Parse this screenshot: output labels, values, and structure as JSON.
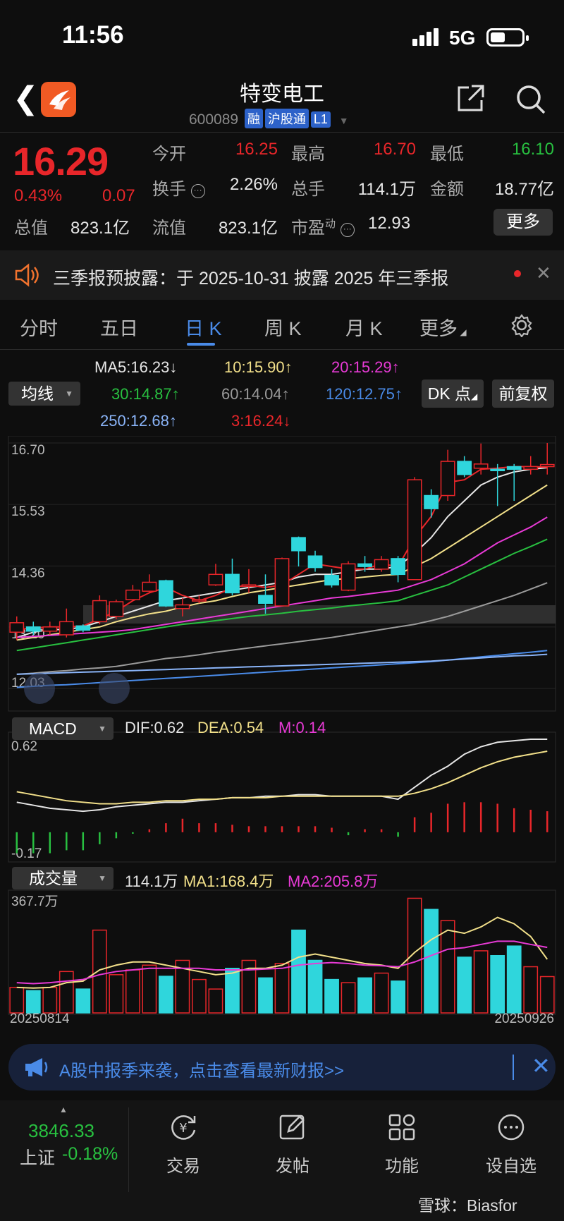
{
  "status": {
    "time": "11:56",
    "network": "5G"
  },
  "header": {
    "stock_name": "特变电工",
    "code": "600089",
    "tags": [
      "融",
      "沪股通",
      "L1"
    ]
  },
  "quote": {
    "price": "16.29",
    "change_pct": "0.43%",
    "change": "0.07",
    "total_value_label": "总值",
    "total_value": "823.1亿",
    "fields": [
      {
        "label": "今开",
        "value": "16.25",
        "color": "red"
      },
      {
        "label": "最高",
        "value": "16.70",
        "color": "red"
      },
      {
        "label": "最低",
        "value": "16.10",
        "color": "green"
      },
      {
        "label": "换手",
        "value": "2.26%",
        "color": "white"
      },
      {
        "label": "总手",
        "value": "114.1万",
        "color": "white"
      },
      {
        "label": "金额",
        "value": "18.77亿",
        "color": "white"
      },
      {
        "label": "流值",
        "value": "823.1亿",
        "color": "white"
      },
      {
        "label": "市盈",
        "label_sup": "动",
        "value": "12.93",
        "color": "white"
      }
    ],
    "more_label": "更多"
  },
  "notice": {
    "text": "三季报预披露：于 2025-10-31 披露 2025 年三季报"
  },
  "tabs": [
    {
      "label": "分时"
    },
    {
      "label": "五日"
    },
    {
      "label": "日 K",
      "active": true
    },
    {
      "label": "周 K"
    },
    {
      "label": "月 K"
    },
    {
      "label": "更多"
    }
  ],
  "ma_bar": {
    "select_label": "均线",
    "items": [
      {
        "text": "MA5:16.23↓",
        "color": "#e6e6e6"
      },
      {
        "text": "10:15.90↑",
        "color": "#f2e08a"
      },
      {
        "text": "20:15.29↑",
        "color": "#e83ad6"
      },
      {
        "text": "30:14.87↑",
        "color": "#28c040"
      },
      {
        "text": "60:14.04↑",
        "color": "#9a9a9a"
      },
      {
        "text": "120:12.75↑",
        "color": "#4a8be8"
      },
      {
        "text": "250:12.68↑",
        "color": "#8ab4f8"
      },
      {
        "text": "3:16.24↓",
        "color": "#e8262a"
      }
    ],
    "dk_label": "DK 点",
    "adjust_label": "前复权"
  },
  "chart_data": {
    "type": "candlestick",
    "price_axis": {
      "ticks": [
        "16.70",
        "15.53",
        "14.36",
        "13.20",
        "12.03"
      ],
      "max": 16.7,
      "min": 12.03
    },
    "dates": {
      "start": "20250814",
      "end": "20250926"
    },
    "candles": [
      {
        "o": 13.1,
        "c": 13.28,
        "h": 13.4,
        "l": 12.95
      },
      {
        "o": 13.2,
        "c": 13.12,
        "h": 13.3,
        "l": 13.05
      },
      {
        "o": 13.12,
        "c": 13.2,
        "h": 13.3,
        "l": 13.05
      },
      {
        "o": 13.05,
        "c": 13.3,
        "h": 13.55,
        "l": 13.0
      },
      {
        "o": 13.22,
        "c": 13.14,
        "h": 13.25,
        "l": 13.1
      },
      {
        "o": 13.3,
        "c": 13.7,
        "h": 13.8,
        "l": 13.25
      },
      {
        "o": 13.4,
        "c": 13.68,
        "h": 13.72,
        "l": 13.35
      },
      {
        "o": 13.72,
        "c": 13.9,
        "h": 14.0,
        "l": 13.7
      },
      {
        "o": 13.88,
        "c": 14.05,
        "h": 14.2,
        "l": 13.85
      },
      {
        "o": 14.08,
        "c": 13.6,
        "h": 14.1,
        "l": 13.58
      },
      {
        "o": 13.55,
        "c": 13.62,
        "h": 13.75,
        "l": 13.4
      },
      {
        "o": 13.72,
        "c": 13.72,
        "h": 13.8,
        "l": 13.65
      },
      {
        "o": 14.0,
        "c": 14.2,
        "h": 14.4,
        "l": 13.98
      },
      {
        "o": 14.2,
        "c": 13.85,
        "h": 14.5,
        "l": 13.8
      },
      {
        "o": 14.0,
        "c": 14.0,
        "h": 14.3,
        "l": 13.85
      },
      {
        "o": 13.8,
        "c": 13.65,
        "h": 14.2,
        "l": 13.45
      },
      {
        "o": 13.6,
        "c": 14.5,
        "h": 14.52,
        "l": 13.6
      },
      {
        "o": 14.9,
        "c": 14.65,
        "h": 14.92,
        "l": 14.35
      },
      {
        "o": 14.55,
        "c": 14.33,
        "h": 14.65,
        "l": 14.25
      },
      {
        "o": 14.18,
        "c": 14.0,
        "h": 14.3,
        "l": 13.95
      },
      {
        "o": 13.9,
        "c": 14.4,
        "h": 14.45,
        "l": 13.88
      },
      {
        "o": 14.4,
        "c": 14.35,
        "h": 14.55,
        "l": 14.25
      },
      {
        "o": 14.3,
        "c": 14.48,
        "h": 14.55,
        "l": 14.25
      },
      {
        "o": 14.5,
        "c": 14.2,
        "h": 14.55,
        "l": 14.05
      },
      {
        "o": 14.1,
        "c": 16.0,
        "h": 16.05,
        "l": 14.1
      },
      {
        "o": 15.7,
        "c": 15.45,
        "h": 15.82,
        "l": 15.28
      },
      {
        "o": 15.7,
        "c": 16.35,
        "h": 16.57,
        "l": 15.6
      },
      {
        "o": 16.35,
        "c": 16.1,
        "h": 16.45,
        "l": 16.05
      },
      {
        "o": 16.22,
        "c": 16.3,
        "h": 16.69,
        "l": 16.1
      },
      {
        "o": 16.2,
        "c": 16.18,
        "h": 16.3,
        "l": 15.5
      },
      {
        "o": 16.25,
        "c": 16.2,
        "h": 16.3,
        "l": 15.6
      },
      {
        "o": 16.2,
        "c": 16.25,
        "h": 16.45,
        "l": 16.1
      },
      {
        "o": 16.25,
        "c": 16.29,
        "h": 16.7,
        "l": 16.1
      }
    ],
    "ma_lines": [
      {
        "name": "MA5",
        "color": "#e6e6e6",
        "values": [
          13.0,
          13.1,
          13.15,
          13.15,
          13.2,
          13.3,
          13.4,
          13.5,
          13.6,
          13.7,
          13.75,
          13.8,
          13.85,
          13.9,
          13.95,
          14.0,
          14.05,
          14.15,
          14.2,
          14.2,
          14.25,
          14.3,
          14.3,
          14.35,
          14.6,
          14.9,
          15.3,
          15.6,
          15.9,
          16.05,
          16.15,
          16.2,
          16.23
        ]
      },
      {
        "name": "MA10",
        "color": "#f2e08a",
        "values": [
          12.95,
          13.0,
          13.05,
          13.1,
          13.15,
          13.2,
          13.3,
          13.38,
          13.45,
          13.5,
          13.58,
          13.65,
          13.7,
          13.78,
          13.85,
          13.9,
          13.95,
          14.0,
          14.05,
          14.1,
          14.12,
          14.15,
          14.18,
          14.2,
          14.35,
          14.5,
          14.7,
          14.9,
          15.1,
          15.3,
          15.5,
          15.7,
          15.9
        ]
      },
      {
        "name": "MA20",
        "color": "#e83ad6",
        "values": [
          13.0,
          13.02,
          13.04,
          13.06,
          13.08,
          13.1,
          13.12,
          13.15,
          13.2,
          13.25,
          13.3,
          13.35,
          13.4,
          13.45,
          13.5,
          13.55,
          13.6,
          13.65,
          13.7,
          13.75,
          13.78,
          13.82,
          13.86,
          13.9,
          14.0,
          14.1,
          14.25,
          14.4,
          14.6,
          14.8,
          14.95,
          15.1,
          15.29
        ]
      },
      {
        "name": "MA30",
        "color": "#28c040",
        "values": [
          12.75,
          12.8,
          12.85,
          12.9,
          12.95,
          13.0,
          13.05,
          13.1,
          13.15,
          13.2,
          13.25,
          13.28,
          13.32,
          13.36,
          13.4,
          13.43,
          13.46,
          13.5,
          13.53,
          13.56,
          13.6,
          13.63,
          13.66,
          13.7,
          13.8,
          13.9,
          14.0,
          14.15,
          14.3,
          14.45,
          14.6,
          14.73,
          14.87
        ]
      },
      {
        "name": "MA60",
        "color": "#9a9a9a",
        "values": [
          12.3,
          12.32,
          12.35,
          12.37,
          12.4,
          12.42,
          12.45,
          12.5,
          12.55,
          12.6,
          12.63,
          12.67,
          12.72,
          12.76,
          12.8,
          12.84,
          12.88,
          12.92,
          12.96,
          13.0,
          13.05,
          13.1,
          13.15,
          13.2,
          13.25,
          13.32,
          13.4,
          13.5,
          13.6,
          13.7,
          13.8,
          13.92,
          14.04
        ]
      },
      {
        "name": "MA120",
        "color": "#4a8be8",
        "values": [
          12.05,
          12.07,
          12.09,
          12.1,
          12.12,
          12.14,
          12.16,
          12.18,
          12.2,
          12.22,
          12.24,
          12.26,
          12.28,
          12.3,
          12.32,
          12.34,
          12.36,
          12.38,
          12.4,
          12.42,
          12.44,
          12.46,
          12.48,
          12.5,
          12.52,
          12.54,
          12.57,
          12.6,
          12.63,
          12.66,
          12.69,
          12.72,
          12.75
        ]
      },
      {
        "name": "MA250",
        "color": "#8ab4f8",
        "values": [
          12.3,
          12.31,
          12.32,
          12.33,
          12.34,
          12.35,
          12.36,
          12.37,
          12.38,
          12.39,
          12.4,
          12.41,
          12.42,
          12.43,
          12.44,
          12.45,
          12.46,
          12.47,
          12.48,
          12.49,
          12.5,
          12.51,
          12.52,
          12.53,
          12.54,
          12.55,
          12.57,
          12.59,
          12.61,
          12.63,
          12.65,
          12.66,
          12.68
        ]
      },
      {
        "name": "MA3",
        "color": "#e8262a",
        "values": [
          13.15,
          13.18,
          13.2,
          13.2,
          13.22,
          13.35,
          13.5,
          13.7,
          13.85,
          13.95,
          13.8,
          13.7,
          13.8,
          13.95,
          14.0,
          13.95,
          14.0,
          14.2,
          14.4,
          14.35,
          14.3,
          14.3,
          14.4,
          14.35,
          14.9,
          15.3,
          15.95,
          16.0,
          16.2,
          16.22,
          16.25,
          16.25,
          16.24
        ]
      }
    ],
    "macd": {
      "select_label": "MACD",
      "dif_label": "DIF:0.62",
      "dea_label": "DEA:0.54",
      "m_label": "M:0.14",
      "axis": {
        "top": "0.62",
        "bottom": "-0.17",
        "max": 0.62,
        "min": -0.17
      },
      "dif": [
        0.2,
        0.18,
        0.16,
        0.15,
        0.14,
        0.15,
        0.17,
        0.18,
        0.19,
        0.2,
        0.2,
        0.21,
        0.22,
        0.23,
        0.23,
        0.24,
        0.24,
        0.25,
        0.25,
        0.24,
        0.24,
        0.24,
        0.24,
        0.22,
        0.3,
        0.38,
        0.44,
        0.52,
        0.57,
        0.6,
        0.61,
        0.62,
        0.62
      ],
      "dea": [
        0.27,
        0.25,
        0.23,
        0.21,
        0.2,
        0.19,
        0.19,
        0.2,
        0.2,
        0.21,
        0.21,
        0.22,
        0.22,
        0.23,
        0.23,
        0.23,
        0.24,
        0.24,
        0.24,
        0.24,
        0.24,
        0.24,
        0.24,
        0.24,
        0.26,
        0.29,
        0.33,
        0.38,
        0.43,
        0.47,
        0.5,
        0.52,
        0.54
      ],
      "hist": [
        -0.14,
        -0.14,
        -0.14,
        -0.12,
        -0.12,
        -0.08,
        -0.04,
        -0.01,
        0.02,
        0.06,
        0.09,
        0.06,
        0.06,
        0.05,
        0.04,
        0.04,
        0.04,
        0.04,
        0.04,
        0.03,
        -0.02,
        0.02,
        0.02,
        -0.03,
        0.1,
        0.13,
        0.19,
        0.2,
        0.2,
        0.19,
        0.16,
        0.15,
        0.14
      ]
    },
    "volume": {
      "select_label": "成交量",
      "value_label": "114.1万",
      "ma1_label": "MA1:168.4万",
      "ma2_label": "MA2:205.8万",
      "axis_top": "367.7万",
      "max": 367.7,
      "bars": [
        80,
        70,
        80,
        130,
        75,
        260,
        120,
        135,
        150,
        115,
        165,
        105,
        75,
        140,
        165,
        110,
        155,
        260,
        165,
        105,
        95,
        110,
        125,
        100,
        360,
        325,
        290,
        175,
        195,
        180,
        210,
        145,
        114.1
      ],
      "ma1": [
        80,
        78,
        80,
        95,
        100,
        135,
        150,
        160,
        160,
        150,
        140,
        130,
        120,
        125,
        140,
        140,
        150,
        175,
        185,
        175,
        165,
        155,
        150,
        140,
        190,
        230,
        260,
        250,
        270,
        300,
        280,
        240,
        168.4
      ],
      "ma2": [
        95,
        92,
        95,
        100,
        105,
        120,
        130,
        135,
        140,
        140,
        140,
        140,
        135,
        135,
        135,
        138,
        140,
        150,
        155,
        158,
        155,
        150,
        148,
        145,
        160,
        180,
        200,
        205,
        215,
        225,
        225,
        215,
        205.8
      ]
    }
  },
  "bottom_tip": {
    "text": "A股中报季来袭，点击查看最新财报>>"
  },
  "bottom_bar": {
    "index_value": "3846.33",
    "index_name": "上证",
    "index_pct": "-0.18%",
    "items": [
      {
        "label": "交易",
        "icon": "trade-icon"
      },
      {
        "label": "发帖",
        "icon": "post-icon"
      },
      {
        "label": "功能",
        "icon": "apps-icon"
      },
      {
        "label": "设自选",
        "icon": "watchlist-icon"
      }
    ]
  },
  "watermark": "雪球：Biasfor"
}
